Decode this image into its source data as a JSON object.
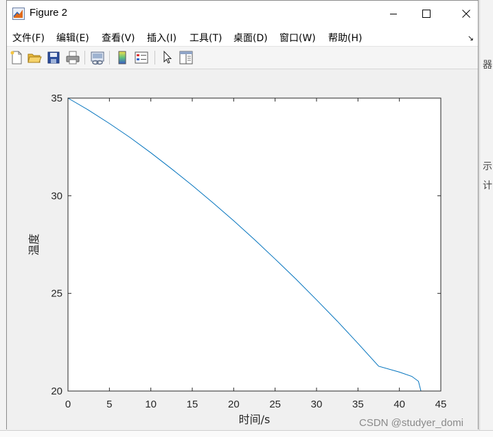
{
  "window": {
    "title": "Figure 2",
    "icon": "matlab-figure-icon"
  },
  "menu": {
    "items": [
      {
        "label": "文件(F)"
      },
      {
        "label": "编辑(E)"
      },
      {
        "label": "查看(V)"
      },
      {
        "label": "插入(I)"
      },
      {
        "label": "工具(T)"
      },
      {
        "label": "桌面(D)"
      },
      {
        "label": "窗口(W)"
      },
      {
        "label": "帮助(H)"
      }
    ],
    "overflow_arrow": "↘"
  },
  "toolbar": {
    "buttons": [
      {
        "icon": "new-figure-icon"
      },
      {
        "icon": "open-file-icon"
      },
      {
        "icon": "save-icon"
      },
      {
        "icon": "print-icon"
      },
      {
        "icon": "link-plot-icon"
      },
      {
        "icon": "colorbar-icon"
      },
      {
        "icon": "legend-icon"
      },
      {
        "icon": "pointer-edit-icon"
      },
      {
        "icon": "property-inspector-icon"
      }
    ]
  },
  "background_glyphs": {
    "g1": "示",
    "g2": "计",
    "g3": "器"
  },
  "watermark": "CSDN @studyer_domi",
  "chart_data": {
    "type": "line",
    "title": "",
    "xlabel": "时间/s",
    "ylabel": "温度",
    "xlim": [
      0,
      45
    ],
    "ylim": [
      20,
      35
    ],
    "xticks": [
      0,
      5,
      10,
      15,
      20,
      25,
      30,
      35,
      40,
      45
    ],
    "yticks": [
      20,
      25,
      30,
      35
    ],
    "grid": false,
    "color": "#0072bd",
    "series": [
      {
        "x": [
          0,
          2.5,
          5,
          7.5,
          10,
          12.5,
          15,
          17.5,
          20,
          22.5,
          25,
          27.5,
          30,
          32.5,
          35,
          37.5,
          40,
          41.5,
          42.3,
          42.6
        ],
        "y": [
          35,
          34.38,
          33.7,
          32.98,
          32.2,
          31.38,
          30.53,
          29.64,
          28.72,
          27.76,
          26.76,
          25.74,
          24.67,
          23.58,
          22.44,
          21.27,
          20.97,
          20.75,
          20.5,
          20.0
        ]
      }
    ]
  }
}
